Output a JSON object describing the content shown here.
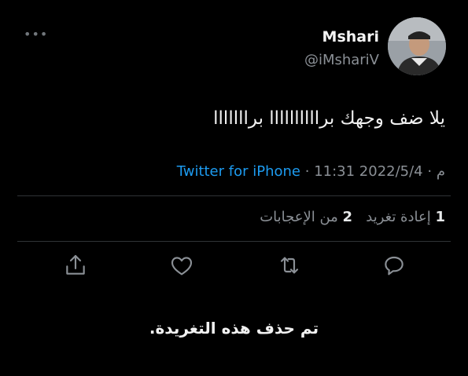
{
  "tweet": {
    "author_name": "Mshari",
    "author_handle": "@iMshariV",
    "text": "يلا ضف وجهك براااااااااا برااااااا",
    "date": "2022/5/4",
    "time": "11:31 م",
    "separator": "·",
    "source": "Twitter for iPhone",
    "retweets_count": "1",
    "retweets_label": "إعادة تغريد",
    "likes_count": "2",
    "likes_label": "من الإعجابات",
    "deleted_notice": "تم حذف هذه التغريدة."
  },
  "icons": {
    "more": "more-horizontal-icon",
    "reply": "reply-icon",
    "retweet": "retweet-icon",
    "like": "heart-icon",
    "share": "share-icon"
  },
  "colors": {
    "background": "#000000",
    "primary_text": "#e7e9ea",
    "secondary_text": "#8b9096",
    "link": "#1d9bf0",
    "divider": "#2f3336"
  }
}
